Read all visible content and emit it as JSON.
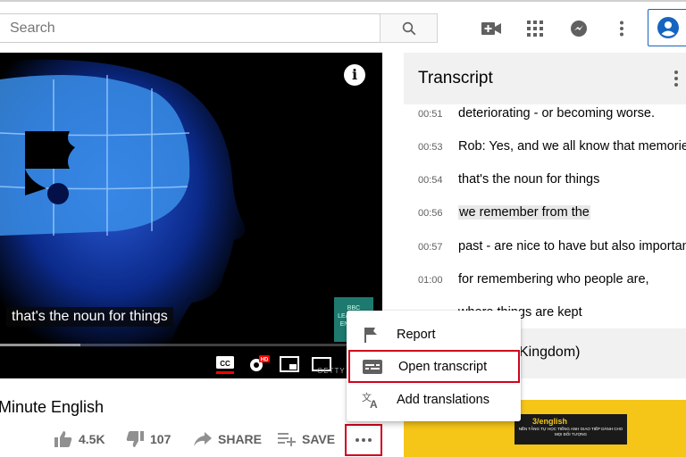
{
  "search": {
    "placeholder": "Search"
  },
  "topbar": {
    "icons": [
      "search-icon",
      "create-video-icon",
      "apps-grid-icon",
      "messages-icon",
      "more-vert-icon",
      "account-icon"
    ]
  },
  "video": {
    "caption": "that's the noun for things",
    "watermark": "BBC LEARNING ENGLISH",
    "getty": "GETTY",
    "progress_fraction": 0.21,
    "controls": [
      "captions-icon",
      "settings-hd-icon",
      "miniplayer-icon",
      "theater-mode-icon"
    ]
  },
  "video_info": {
    "title": "Minute English",
    "likes": "4.5K",
    "dislikes": "107",
    "share_label": "SHARE",
    "save_label": "SAVE"
  },
  "transcript": {
    "title": "Transcript",
    "lines": [
      {
        "time": "00:51",
        "text": "deteriorating - or becoming worse."
      },
      {
        "time": "00:53",
        "text": "Rob: Yes, and we all know that memories"
      },
      {
        "time": "00:54",
        "text": "that's the noun for things"
      },
      {
        "time": "00:56",
        "text": "we remember from the"
      },
      {
        "time": "00:57",
        "text": "past - are nice to have but also important"
      },
      {
        "time": "01:00",
        "text": "for remembering who people are,"
      },
      {
        "time": "",
        "text": "where things are kept"
      }
    ],
    "language_visible": "Kingdom)"
  },
  "ad": {
    "logo": "3/english",
    "text": "NỀN TẢNG TỰ HỌC TIẾNG ANH GIAO TIẾP DÀNH CHO MỌI ĐỐI TƯỢNG"
  },
  "menu": {
    "items": [
      {
        "label": "Report",
        "icon": "flag-icon"
      },
      {
        "label": "Open transcript",
        "icon": "transcript-icon"
      },
      {
        "label": "Add translations",
        "icon": "translate-icon"
      }
    ]
  },
  "colors": {
    "highlight_border": "#d0021b",
    "account_blue": "#1565c0",
    "panel_bg": "#f1f1f1",
    "ad_yellow": "#f5c518"
  }
}
